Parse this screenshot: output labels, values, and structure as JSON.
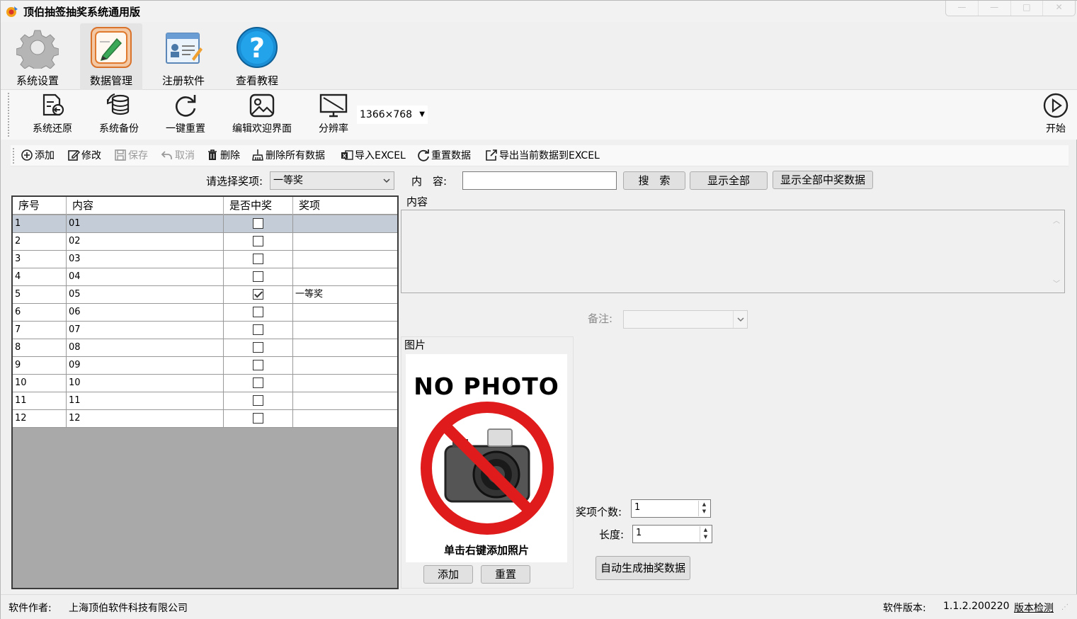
{
  "window": {
    "title": "顶伯抽签抽奖系统通用版",
    "controls": [
      "—",
      "—",
      "□",
      "✕"
    ]
  },
  "ribbon": {
    "tabs": [
      {
        "label": "系统设置",
        "icon": "gear-icon"
      },
      {
        "label": "数据管理",
        "icon": "data-edit-icon",
        "active": true
      },
      {
        "label": "注册软件",
        "icon": "register-card-icon"
      },
      {
        "label": "查看教程",
        "icon": "help-question-icon"
      }
    ]
  },
  "toolbar": {
    "buttons": [
      {
        "label": "系统还原",
        "icon": "restore-icon"
      },
      {
        "label": "系统备份",
        "icon": "backup-database-icon"
      },
      {
        "label": "一键重置",
        "icon": "refresh-icon"
      },
      {
        "label": "编辑欢迎界面",
        "icon": "image-edit-icon"
      },
      {
        "label": "分辨率",
        "icon": "monitor-icon"
      }
    ],
    "resolution": "1366×768",
    "start_label": "开始"
  },
  "actions": {
    "add": "添加",
    "edit": "修改",
    "save": "保存",
    "cancel": "取消",
    "delete": "删除",
    "delete_all": "删除所有数据",
    "import_excel": "导入EXCEL",
    "reset_data": "重置数据",
    "export_excel": "导出当前数据到EXCEL"
  },
  "filter": {
    "prize_label": "请选择奖项:",
    "prize_value": "一等奖",
    "content_label": "内　容:",
    "search_label": "搜　索",
    "show_all_label": "显示全部",
    "show_winners_label": "显示全部中奖数据"
  },
  "grid": {
    "columns": [
      "序号",
      "内容",
      "是否中奖",
      "奖项"
    ],
    "rows": [
      {
        "index": "1",
        "content": "01",
        "won": false,
        "prize": ""
      },
      {
        "index": "2",
        "content": "02",
        "won": false,
        "prize": ""
      },
      {
        "index": "3",
        "content": "03",
        "won": false,
        "prize": ""
      },
      {
        "index": "4",
        "content": "04",
        "won": false,
        "prize": ""
      },
      {
        "index": "5",
        "content": "05",
        "won": true,
        "prize": "一等奖"
      },
      {
        "index": "6",
        "content": "06",
        "won": false,
        "prize": ""
      },
      {
        "index": "7",
        "content": "07",
        "won": false,
        "prize": ""
      },
      {
        "index": "8",
        "content": "08",
        "won": false,
        "prize": ""
      },
      {
        "index": "9",
        "content": "09",
        "won": false,
        "prize": ""
      },
      {
        "index": "10",
        "content": "10",
        "won": false,
        "prize": ""
      },
      {
        "index": "11",
        "content": "11",
        "won": false,
        "prize": ""
      },
      {
        "index": "12",
        "content": "12",
        "won": false,
        "prize": ""
      }
    ]
  },
  "detail": {
    "content_legend": "内容",
    "remark_label": "备注:",
    "image_legend": "图片",
    "no_photo_title": "NO PHOTO",
    "no_photo_hint": "单击右键添加照片",
    "add_photo_label": "添加",
    "reset_photo_label": "重置",
    "prize_count_label": "奖项个数:",
    "prize_count_value": "1",
    "length_label": "长度:",
    "length_value": "1",
    "autogen_label": "自动生成抽奖数据"
  },
  "status": {
    "author_label": "软件作者:",
    "author_value": "上海顶伯软件科技有限公司",
    "version_label": "软件版本:",
    "version_value": "1.1.2.200220",
    "check_label": "版本检测"
  },
  "colors": {
    "selected_row": "#c4ccd8",
    "grid_empty": "#a9a9a9",
    "accent_orange": "#e07a2e",
    "help_blue": "#1b8fd6",
    "no_photo_red": "#e01b1b"
  }
}
